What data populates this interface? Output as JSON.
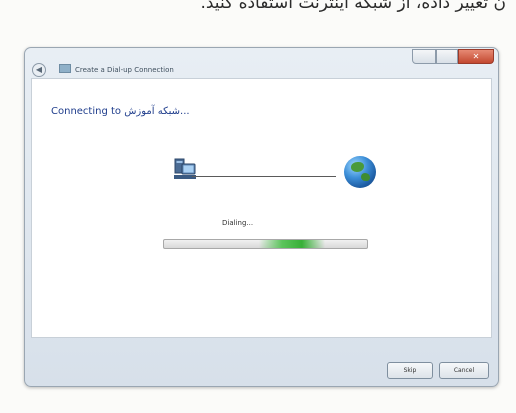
{
  "top_caption": {
    "text": "ن تغییر داده، از شبکه اینترنت استفاده کنید."
  },
  "window": {
    "title": "Create a Dial-up Connection",
    "back_label": "◀",
    "close_label": "✕",
    "heading": "Connecting to شبکه آموزش...",
    "status": "Dialing...",
    "progress_fraction": 0.47,
    "buttons": {
      "skip": "Skip",
      "cancel": "Cancel"
    }
  }
}
